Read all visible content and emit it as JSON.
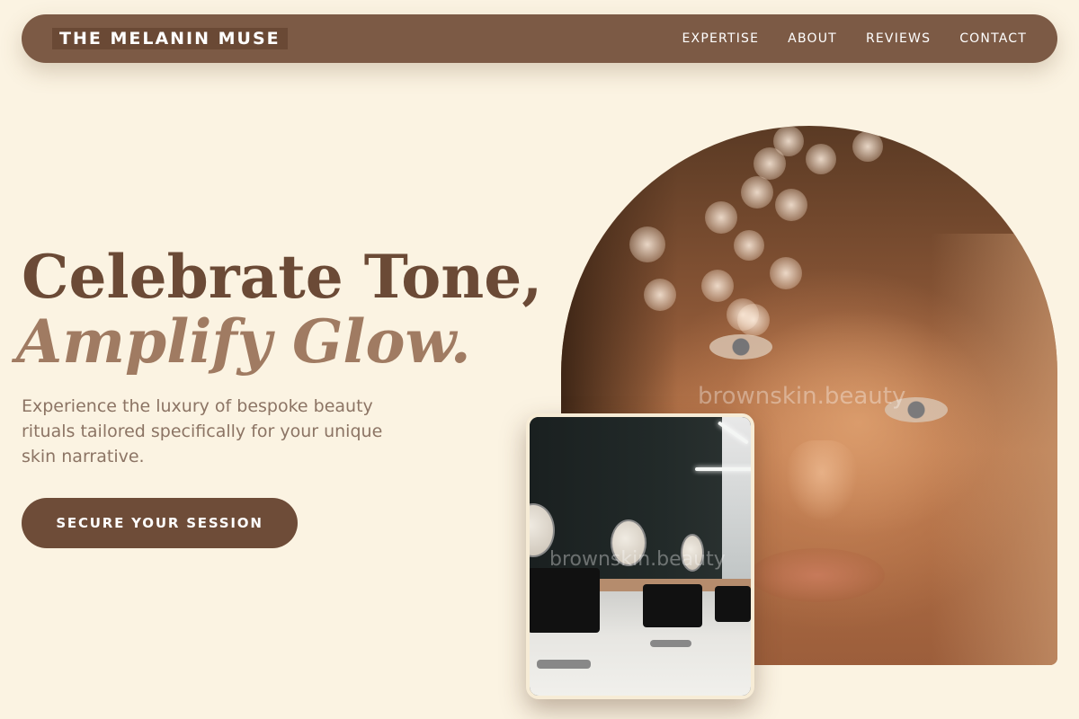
{
  "header": {
    "brand": "THE MELANIN MUSE",
    "nav": [
      "EXPERTISE",
      "ABOUT",
      "REVIEWS",
      "CONTACT"
    ]
  },
  "hero": {
    "title_line1": "Celebrate Tone,",
    "title_line2": "Amplify Glow.",
    "subtitle": "Experience the luxury of bespoke beauty rituals tailored specifically for your unique skin narrative.",
    "cta_label": "SECURE YOUR SESSION"
  },
  "images": {
    "portrait_watermark": "brownskin.beauty",
    "salon_watermark": "brownskin.beauty"
  },
  "colors": {
    "background": "#fbf3e2",
    "nav_bg": "#7c5a45",
    "title": "#6b4a36",
    "title_italic": "#a07b62",
    "cta_bg": "#6e4c38"
  }
}
